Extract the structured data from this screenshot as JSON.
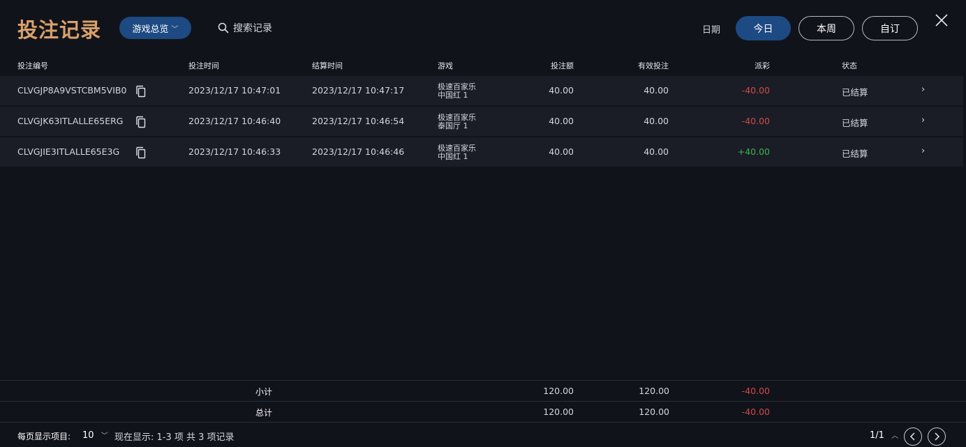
{
  "header": {
    "title": "投注记录",
    "overview_label": "游戏总览",
    "search_label": "搜索记录",
    "date_label": "日期",
    "ranges": [
      "今日",
      "本周",
      "自订"
    ],
    "active_range": "今日"
  },
  "table": {
    "columns": [
      "投注编号",
      "投注时间",
      "结算时间",
      "游戏",
      "投注额",
      "有效投注",
      "派彩",
      "状态"
    ],
    "rows": [
      {
        "id": "CLVGJP8A9VSTCBM5VIB0",
        "bet_time": "2023/12/17 10:47:01",
        "settle_time": "2023/12/17 10:47:17",
        "game_line1": "极速百家乐",
        "game_line2": "中国红 1",
        "amount": "40.00",
        "valid": "40.00",
        "payout": "-40.00",
        "status": "已结算"
      },
      {
        "id": "CLVGJK63ITLALLE65ERG",
        "bet_time": "2023/12/17 10:46:40",
        "settle_time": "2023/12/17 10:46:54",
        "game_line1": "极速百家乐",
        "game_line2": "泰国厅 1",
        "amount": "40.00",
        "valid": "40.00",
        "payout": "-40.00",
        "status": "已结算"
      },
      {
        "id": "CLVGJIE3ITLALLE65E3G",
        "bet_time": "2023/12/17 10:46:33",
        "settle_time": "2023/12/17 10:46:46",
        "game_line1": "极速百家乐",
        "game_line2": "中国红 1",
        "amount": "40.00",
        "valid": "40.00",
        "payout": "+40.00",
        "status": "已结算"
      }
    ]
  },
  "subtotal": {
    "label": "小计",
    "amount": "120.00",
    "valid": "120.00",
    "payout": "-40.00"
  },
  "total": {
    "label": "总计",
    "amount": "120.00",
    "valid": "120.00",
    "payout": "-40.00"
  },
  "footer": {
    "per_page_label": "每页显示项目:",
    "per_page_value": "10",
    "showing": "现在显示: 1-3 项 共 3 项记录",
    "page": "1/1"
  },
  "colors": {
    "accent": "#1d4a82",
    "title": "#d9a06a",
    "negative": "#d04a4a",
    "positive": "#3db54a"
  },
  "icons": {
    "search": "search-icon",
    "copy": "copy-icon",
    "close": "close-icon",
    "chevron": "chevron-right-icon"
  }
}
